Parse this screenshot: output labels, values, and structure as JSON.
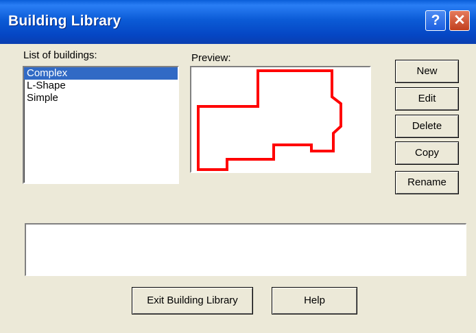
{
  "window": {
    "title": "Building Library",
    "help_glyph": "?",
    "close_glyph": "✕"
  },
  "list": {
    "label": "List of buildings:",
    "items": [
      "Complex",
      "L-Shape",
      "Simple"
    ],
    "selected": "Complex"
  },
  "preview": {
    "label": "Preview:",
    "outline_color": "#ff0000"
  },
  "buttons": {
    "new": "New",
    "edit": "Edit",
    "delete": "Delete",
    "copy": "Copy",
    "rename": "Rename",
    "exit": "Exit Building Library",
    "help": "Help"
  },
  "message": ""
}
